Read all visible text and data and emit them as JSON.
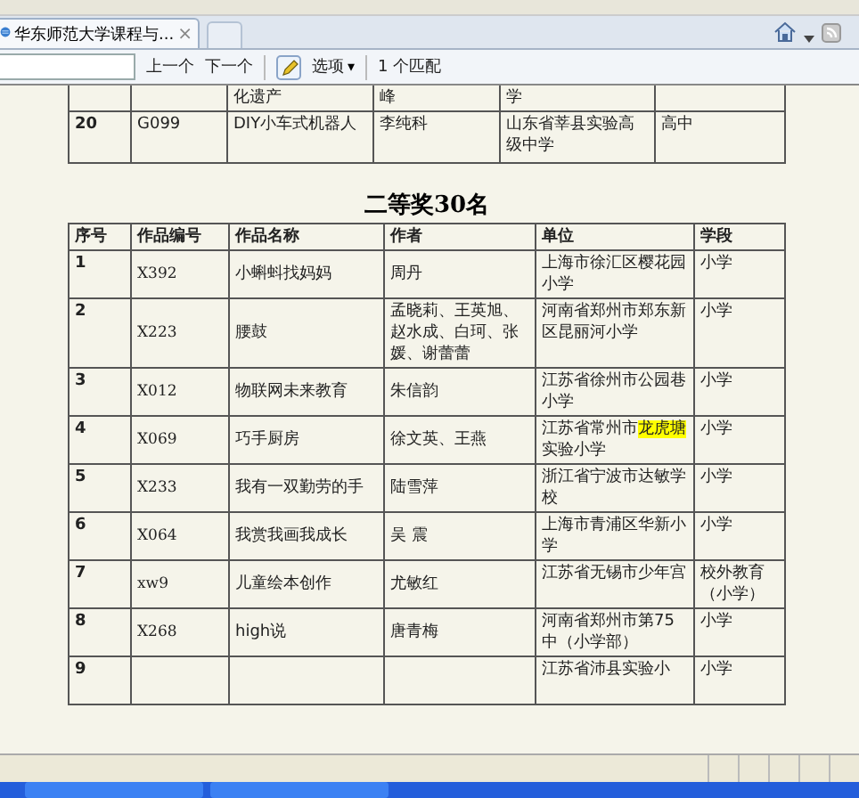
{
  "tab": {
    "title": "华东师范大学课程与...",
    "close": "×"
  },
  "find_bar": {
    "previous": "上一个",
    "next": "下一个",
    "options": "选项",
    "options_caret": "▾",
    "matches": "1 个匹配"
  },
  "top_table": {
    "rows": [
      {
        "cells": [
          "",
          "",
          "化遗产",
          "峰",
          "学",
          ""
        ],
        "partial": true
      },
      {
        "cells": [
          "20",
          "G099",
          "DIY小车式机器人",
          "李纯科",
          "山东省莘县实验高级中学",
          "高中"
        ],
        "partial": false
      }
    ]
  },
  "section_title": "二等奖30名",
  "table": {
    "columns": [
      "序号",
      "作品编号",
      "作品名称",
      "作者",
      "单位",
      "学段"
    ],
    "rows": [
      {
        "seq": "1",
        "code": "X392",
        "name": "小蝌蚪找妈妈",
        "author": "周丹",
        "unit_parts": [
          {
            "text": "上海市徐汇区樱花园小学",
            "highlighted": false
          }
        ],
        "stage": "小学"
      },
      {
        "seq": "2",
        "code": "X223",
        "name": "腰鼓",
        "author": "孟晓莉、王英旭、赵水成、白珂、张媛、谢蕾蕾",
        "unit_parts": [
          {
            "text": "河南省郑州市郑东新区昆丽河小学",
            "highlighted": false
          }
        ],
        "stage": "小学"
      },
      {
        "seq": "3",
        "code": "X012",
        "name": "物联网未来教育",
        "author": "朱信韵",
        "unit_parts": [
          {
            "text": "江苏省徐州市公园巷小学",
            "highlighted": false
          }
        ],
        "stage": "小学"
      },
      {
        "seq": "4",
        "code": "X069",
        "name": "巧手厨房",
        "author": "徐文英、王燕",
        "unit_parts": [
          {
            "text": "江苏省常州市",
            "highlighted": false
          },
          {
            "text": "龙虎塘",
            "highlighted": true
          },
          {
            "text": "实验小学",
            "highlighted": false
          }
        ],
        "stage": "小学"
      },
      {
        "seq": "5",
        "code": "X233",
        "name": "我有一双勤劳的手",
        "author": "陆雪萍",
        "unit_parts": [
          {
            "text": "浙江省宁波市达敏学校",
            "highlighted": false
          }
        ],
        "stage": "小学"
      },
      {
        "seq": "6",
        "code": "X064",
        "name": "我赏我画我成长",
        "author": "吴 震",
        "unit_parts": [
          {
            "text": "上海市青浦区华新小学",
            "highlighted": false
          }
        ],
        "stage": "小学"
      },
      {
        "seq": "7",
        "code": "xw9",
        "name": "儿童绘本创作",
        "author": "尤敏红",
        "unit_parts": [
          {
            "text": "江苏省无锡市少年宫",
            "highlighted": false
          }
        ],
        "stage": "校外教育（小学）"
      },
      {
        "seq": "8",
        "code": "X268",
        "name": "high说",
        "author": "唐青梅",
        "unit_parts": [
          {
            "text": "河南省郑州市第75中（小学部）",
            "highlighted": false
          }
        ],
        "stage": "小学"
      },
      {
        "seq": "9",
        "code": "",
        "name": "",
        "author": "",
        "unit_parts": [
          {
            "text": "江苏省沛县实验小",
            "highlighted": false
          }
        ],
        "stage": "小学"
      }
    ]
  }
}
